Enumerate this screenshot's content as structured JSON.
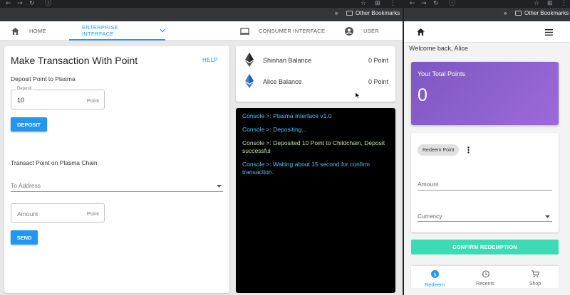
{
  "left_window": {
    "tabs": [
      {
        "label": "HOME"
      },
      {
        "label": "ENTERPRISE INTERFACE"
      },
      {
        "label": "CONSUMER INTERFACE"
      },
      {
        "label": "USER"
      }
    ],
    "bookmarks": {
      "label": "Other Bookmarks",
      "more": "»"
    },
    "transaction_card": {
      "title": "Make Transaction With Point",
      "help_label": "HELP",
      "deposit_section_title": "Deposit Point to Plasma",
      "deposit_field_label": "Deposit",
      "deposit_value": "10",
      "deposit_unit": "Point",
      "deposit_button": "DEPOSIT",
      "transact_section_title": "Transact Point on Plasma Chain",
      "to_address_placeholder": "To Address",
      "amount_placeholder": "Amount",
      "amount_unit": "Point",
      "send_button": "SEND"
    },
    "balances": [
      {
        "label": "Shinhan Balance",
        "value": "0 Point"
      },
      {
        "label": "Alice Balance",
        "value": "0 Point"
      }
    ],
    "console_lines": [
      {
        "text": "Console >: Plasma Interface v1.0",
        "color": "#4fc3f7"
      },
      {
        "text": "Console >: Depositing...",
        "color": "#4fc3f7"
      },
      {
        "text": "Console >: Deposited 10 Point to Childchain, Deposit successful",
        "color": "#c5e1a5"
      },
      {
        "text": "Console >: Waiting about 15 second for confirm transaction.",
        "color": "#4fc3f7"
      }
    ]
  },
  "right_window": {
    "bookmarks": {
      "label": "Other Bookmarks",
      "more": "»"
    },
    "welcome": "Welcome back, Alice",
    "points_card": {
      "title": "Your Total Points",
      "value": "0"
    },
    "redeem_chip": "Redeem Point",
    "amount_placeholder": "Amount",
    "currency_placeholder": "Currency",
    "confirm_button": "CONFIRM REDEMPTION",
    "bottom_nav": [
      {
        "label": "Redeem",
        "icon": "dollar-icon"
      },
      {
        "label": "Recents",
        "icon": "history-icon"
      },
      {
        "label": "Shop",
        "icon": "cart-icon"
      }
    ]
  },
  "colors": {
    "accent": "#2196f3",
    "teal": "#3ddbb5",
    "purple_start": "#7e57c2",
    "purple_end": "#9c6ad9"
  }
}
